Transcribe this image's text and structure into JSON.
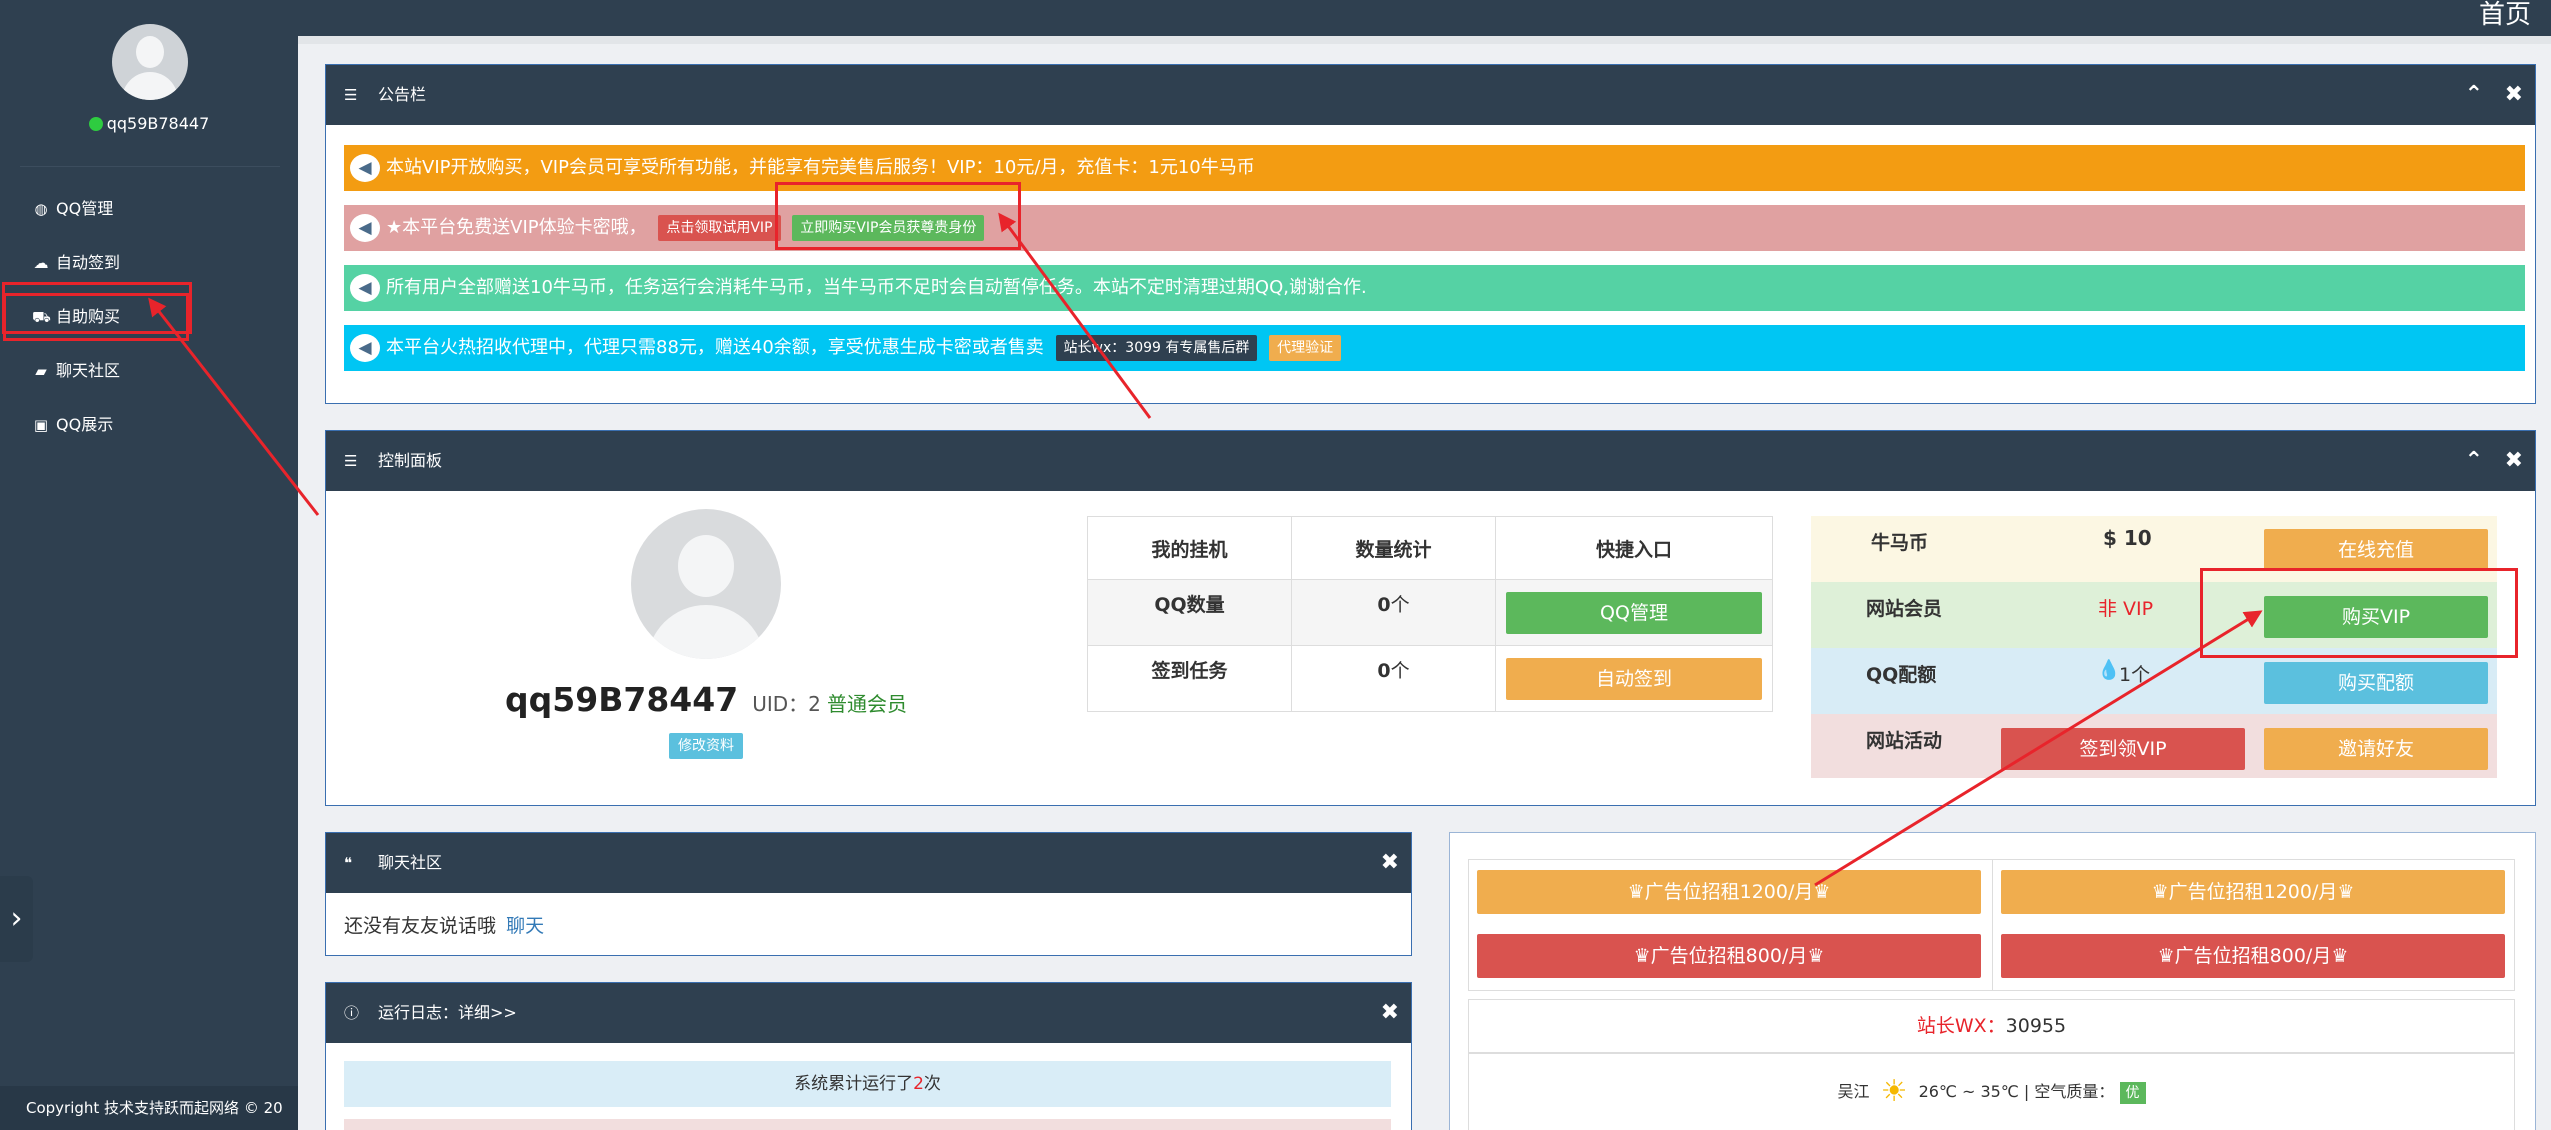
{
  "sidebar": {
    "username": "qq59B78447",
    "items": [
      {
        "label": "QQ管理",
        "icon": "globe-icon"
      },
      {
        "label": "自动签到",
        "icon": "cloud-icon"
      },
      {
        "label": "自助购买",
        "icon": "cart-icon"
      },
      {
        "label": "聊天社区",
        "icon": "comment-icon"
      },
      {
        "label": "QQ展示",
        "icon": "image-icon"
      }
    ],
    "footer": "Copyright 技术支持跃而起网络 © 20"
  },
  "topbar": {
    "title": "首页"
  },
  "notice_panel": {
    "title": "公告栏",
    "notices": [
      {
        "text": "本站VIP开放购买，VIP会员可享受所有功能，并能享有完美售后服务！VIP：10元/月，充值卡：1元10牛马币",
        "color": "#f39c12"
      },
      {
        "text": "★本平台免费送VIP体验卡密哦，",
        "tag1": "点击领取试用VIP",
        "tag2": "立即购买VIP会员获尊贵身份",
        "color": "#e0a1a1"
      },
      {
        "text": "所有用户全部赠送10牛马币，任务运行会消耗牛马币，当牛马币不足时会自动暂停任务。本站不定时清理过期QQ,谢谢合作.",
        "color": "#55d2a4"
      },
      {
        "text": "本平台火热招收代理中，代理只需88元，赠送40余额，享受优惠生成卡密或者售卖",
        "tag1": "站长wx：3099 有专属售后群",
        "tag2": "代理验证",
        "color": "#00c6f3"
      }
    ]
  },
  "control_panel": {
    "title": "控制面板",
    "username": "qq59B78447",
    "uid_label": "UID：2",
    "member_level": "普通会员",
    "edit_button": "修改资料",
    "table": {
      "headers": [
        "我的挂机",
        "数量统计",
        "快捷入口"
      ],
      "rows": [
        {
          "name": "QQ数量",
          "count": "0",
          "unit": "个",
          "button": "QQ管理"
        },
        {
          "name": "签到任务",
          "count": "0",
          "unit": "个",
          "button": "自动签到"
        }
      ]
    },
    "account": [
      {
        "name": "牛马币",
        "value": "$ 10",
        "button": "在线充值"
      },
      {
        "name": "网站会员",
        "value": "非 VIP",
        "button": "购买VIP"
      },
      {
        "name": "QQ配额",
        "value": "1个",
        "button": "购买配额"
      },
      {
        "name": "网站活动",
        "button1": "签到领VIP",
        "button2": "邀请好友"
      }
    ]
  },
  "chat_panel": {
    "title": "聊天社区",
    "text": "还没有友友说话哦",
    "link": "聊天"
  },
  "log_panel": {
    "title": "运行日志：详细>>",
    "line1_prefix": "系统累计运行了",
    "line1_count": "2",
    "line1_suffix": "次"
  },
  "ads": {
    "slots": [
      "广告位招租1200/月",
      "广告位招租1200/月",
      "广告位招租800/月",
      "广告位招租800/月"
    ],
    "contact_label": "站长WX：",
    "contact_value": "30955",
    "weather_city": "吴江",
    "weather_temp": "26℃ ~ 35℃ | 空气质量：",
    "weather_aqi": "优"
  }
}
